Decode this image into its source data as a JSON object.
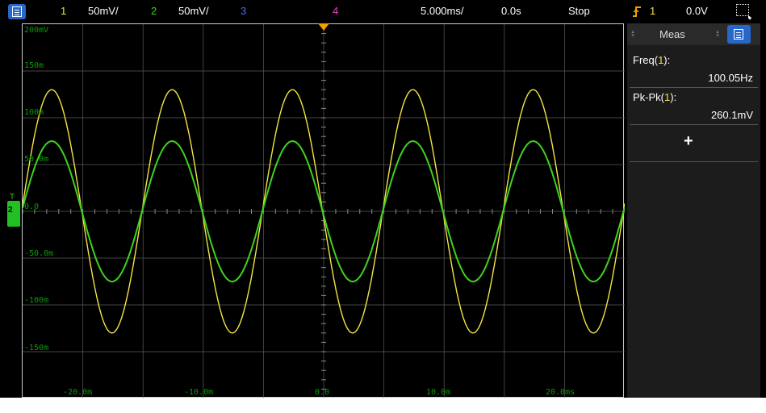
{
  "top_bar": {
    "menu_icon": "menu-icon",
    "ch1_label": "1",
    "ch1_scale": "50mV/",
    "ch2_label": "2",
    "ch2_scale": "50mV/",
    "ch3_label": "3",
    "ch4_label": "4",
    "time_scale": "5.000ms/",
    "time_delay": "0.0s",
    "run_state": "Stop",
    "trigger_icon": "trigger-rising-edge-icon",
    "trigger_source": "1",
    "trigger_level": "0.0V",
    "select_icon": "region-select-icon"
  },
  "colors": {
    "ch1": "#f4e542",
    "ch2": "#3fd21f",
    "ch3": "#4a6df0",
    "ch4": "#f03cd0",
    "trigger": "#f0a000",
    "grid": "#5a5a5a",
    "axis_labels": "#0a9a0a",
    "menu_button": "#2667c9"
  },
  "plot": {
    "y_labels": [
      "200mV",
      "150m",
      "100m",
      "50.0m",
      "0.0",
      "-50.0m",
      "-100m",
      "-150m"
    ],
    "x_labels": [
      "-20.0m",
      "-10.0m",
      "0.0",
      "10.0m",
      "20.0ms"
    ],
    "ground_marker_label": "2",
    "ground_marker_top": "T"
  },
  "chart_data": {
    "type": "line",
    "x_unit": "s",
    "y_unit": "V",
    "xlim": [
      -0.025,
      0.025
    ],
    "ylim": [
      -0.2,
      0.2
    ],
    "grid": true,
    "series": [
      {
        "name": "1",
        "shape": "sine",
        "frequency_hz": 100.05,
        "amplitude_v": 0.13,
        "phase": "starts rising through 0 at left edge, negative before",
        "color": "#f4e542"
      },
      {
        "name": "2",
        "shape": "sine",
        "frequency_hz": 100.05,
        "amplitude_v": 0.075,
        "color": "#3fd21f"
      }
    ]
  },
  "meas_panel": {
    "title": "Meas",
    "items": [
      {
        "label_prefix": "Freq(",
        "channel": "1",
        "label_suffix": "):",
        "value": "100.05Hz"
      },
      {
        "label_prefix": "Pk-Pk(",
        "channel": "1",
        "label_suffix": "):",
        "value": "260.1mV"
      }
    ],
    "add_label": "+"
  }
}
